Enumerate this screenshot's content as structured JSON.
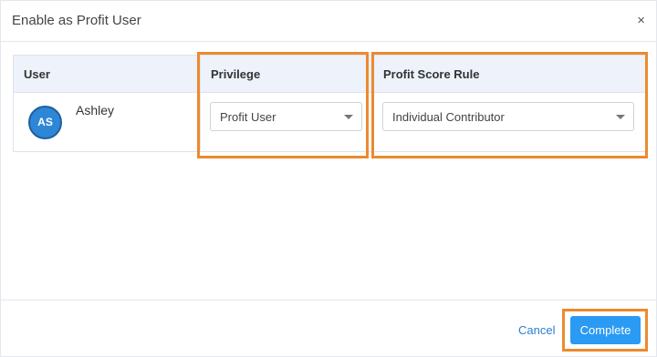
{
  "dialog": {
    "title": "Enable as Profit User",
    "close_label": "×"
  },
  "table": {
    "headers": {
      "user": "User",
      "privilege": "Privilege",
      "profit_score_rule": "Profit Score Rule"
    },
    "row": {
      "avatar_initials": "AS",
      "user_name": "Ashley",
      "privilege_value": "Profit User",
      "profit_score_rule_value": "Individual Contributor"
    }
  },
  "footer": {
    "cancel_label": "Cancel",
    "complete_label": "Complete"
  },
  "colors": {
    "highlight": "#ec8a2f",
    "primary_button": "#2b9af3",
    "avatar": "#2e86d6",
    "header_bg": "#edf2fb"
  }
}
